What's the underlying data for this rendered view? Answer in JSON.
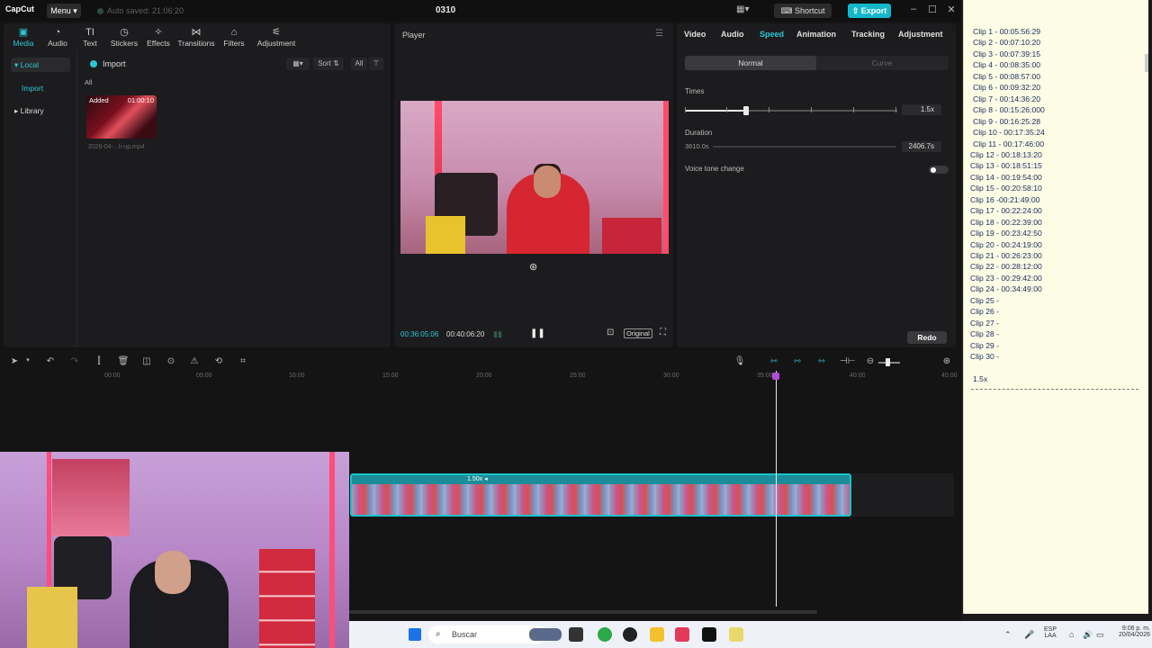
{
  "app": {
    "logo": "CapCut",
    "menu_label": "Menu",
    "autosave": "Auto saved: 21:06:20",
    "title": "0310",
    "shortcut_label": "Shortcut",
    "export_label": "Export"
  },
  "toolbar": {
    "items": [
      {
        "label": "Media",
        "icon": "media-icon"
      },
      {
        "label": "Audio",
        "icon": "audio-icon"
      },
      {
        "label": "Text",
        "icon": "text-icon"
      },
      {
        "label": "Stickers",
        "icon": "stickers-icon"
      },
      {
        "label": "Effects",
        "icon": "effects-icon"
      },
      {
        "label": "Transitions",
        "icon": "transitions-icon"
      },
      {
        "label": "Filters",
        "icon": "filters-icon"
      },
      {
        "label": "Adjustment",
        "icon": "adjustment-icon"
      }
    ]
  },
  "media": {
    "side_items": [
      "Local",
      "Import",
      "Library"
    ],
    "import_label": "Import",
    "sort_label": "Sort",
    "filter_all": "All",
    "section_all": "All",
    "thumb_added": "Added",
    "thumb_duration": "01:00:10",
    "thumb_name": "2026-04-...li-up.mp4"
  },
  "player": {
    "title": "Player",
    "current_time": "00:36:05:06",
    "total_time": "00:40:06:20",
    "ratio_label": "Original"
  },
  "props": {
    "tabs": [
      "Video",
      "Audio",
      "Speed",
      "Animation",
      "Tracking",
      "Adjustment"
    ],
    "seg_on": "Normal",
    "seg_off": "Curve",
    "times_label": "Times",
    "times_value": "1.5x",
    "speed_fraction": 0.29,
    "duration_label": "Duration",
    "duration_from": "3610.0s",
    "duration_value": "2406.7s",
    "voice_tone_label": "Voice tone change",
    "redo_label": "Redo"
  },
  "timeline": {
    "ruler": [
      "00:00",
      "05:00",
      "10:00",
      "15:00",
      "20:00",
      "25:00",
      "30:00",
      "35:00",
      "40:00",
      "45:00"
    ],
    "clip_speed": "1.50x"
  },
  "notes": {
    "lines": [
      "Clip 1 - 00:05:56:29",
      "Clip 2 - 00:07:10:20",
      "Clip 3 - 00:07:39:15",
      "Clip 4 - 00:08:35:00",
      "Clip 5 - 00:08:57:00",
      "Clip 6 - 00:09:32:20",
      "Clip 7 - 00:14:36:20",
      "Clip 8 - 00:15:26:000",
      "Clip 9 - 00:16:25:28",
      "Clip 10 - 00:17:35:24",
      "Clip 11 - 00:17:46:00",
      "Clip 12 - 00:18:13:20",
      "Clip 13 - 00:18:51:15",
      "Clip 14 - 00:19:54:00",
      "Clip 15 - 00:20:58:10",
      "Clip 16 -00:21:49:00",
      "Clip 17 - 00:22:24:00",
      "Clip 18 - 00:22:39:00",
      "Clip 19 - 00:23:42:50",
      "Clip 20 - 00:24:19:00",
      "Clip 21 - 00:26:23:00",
      "Clip 22 - 00:28:12:00",
      "Clip 23 - 00:29:42:00",
      "Clip 24 - 00:34:49:00",
      "Clip 25 -",
      "Clip 26 -",
      "Clip 27 -",
      "Clip 28 -",
      "Clip 29 -",
      "Clip 30 -"
    ],
    "speed_note": "1.5x"
  },
  "taskbar": {
    "search_placeholder": "Buscar",
    "lang": "ESP",
    "lang2": "LAA",
    "time": "9:06 p. m.",
    "date": "20/04/2026"
  },
  "colors": {
    "accent": "#2dc6d6",
    "export": "#14b7c9",
    "notes_bg": "#fdfde6"
  }
}
